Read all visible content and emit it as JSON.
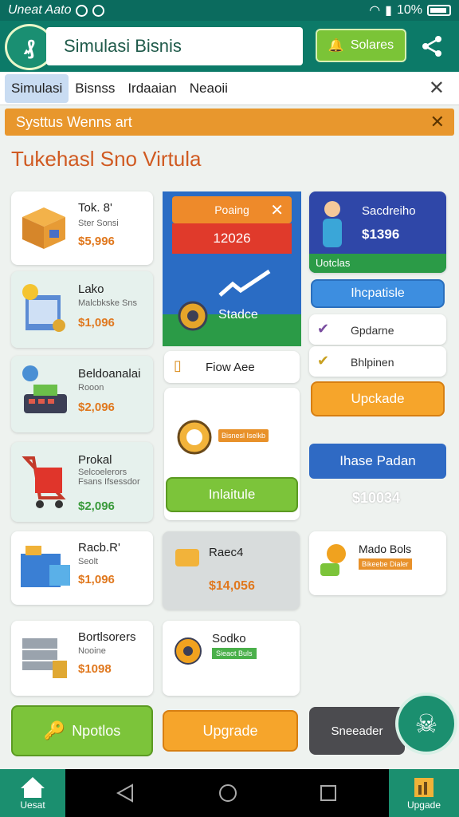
{
  "status_bar": {
    "left_text": "Uneat Aato",
    "battery": "10%"
  },
  "app_bar": {
    "title": "Simulasi Bisnis",
    "action_label": "Solares"
  },
  "tabs": [
    "Simulasi",
    "Bisnss",
    "Irdaaian",
    "Neaoii"
  ],
  "notice": {
    "text": "Systtus Wenns art"
  },
  "heading": "Tukehasl Sno Virtula",
  "shop_cards": [
    {
      "title": "Tok. 8'",
      "sub": "Ster Sonsi",
      "price": "$5,996"
    },
    {
      "title": "Lako",
      "sub": "Malcbkske Sns",
      "price": "$1,096"
    },
    {
      "title": "Beldoanalai",
      "sub": "Rooon",
      "price": "$2,096"
    },
    {
      "title": "Prokal",
      "sub": "Selcoelerors Fsans Ifsessdor",
      "price": "$2,096"
    },
    {
      "title": "Racb.R'",
      "sub": "Seolt",
      "price": "$1,096"
    },
    {
      "title": "Bortlsorers",
      "sub": "Nooine",
      "price": "$1098"
    }
  ],
  "center_panel": {
    "top_label": "Poaing",
    "value": "12026",
    "status": "Stadce",
    "row_label": "Fiow Aee",
    "tag_label": "Bisnesl Iselkb",
    "button_label": "Inlaitule",
    "tile_title": "Raec4",
    "tile_value": "$14,056",
    "gear_title": "Sodko",
    "gear_tag": "Sieaot Buls"
  },
  "right_panel": {
    "profile_title": "Sacdreiho",
    "profile_value": "$1396",
    "profile_footer": "Uotclas",
    "btn_primary": "Ihcpatisle",
    "list_items": [
      "Gpdarne",
      "Bhlpinen"
    ],
    "upgrade_label": "Upckade",
    "promo_title": "Ihase Padan",
    "promo_value": "$10034",
    "bonus_title": "Mado Bols",
    "bonus_tag": "Bikeebe Dialer"
  },
  "bottom_actions": {
    "left": "Npotlos",
    "middle": "Upgrade",
    "right": "Sneeader"
  },
  "nav": {
    "home_label": "Uesat",
    "right_label": "Upgade"
  },
  "colors": {
    "primary": "#0c7a68",
    "accent_orange": "#e8972d",
    "heading": "#d05a21"
  }
}
